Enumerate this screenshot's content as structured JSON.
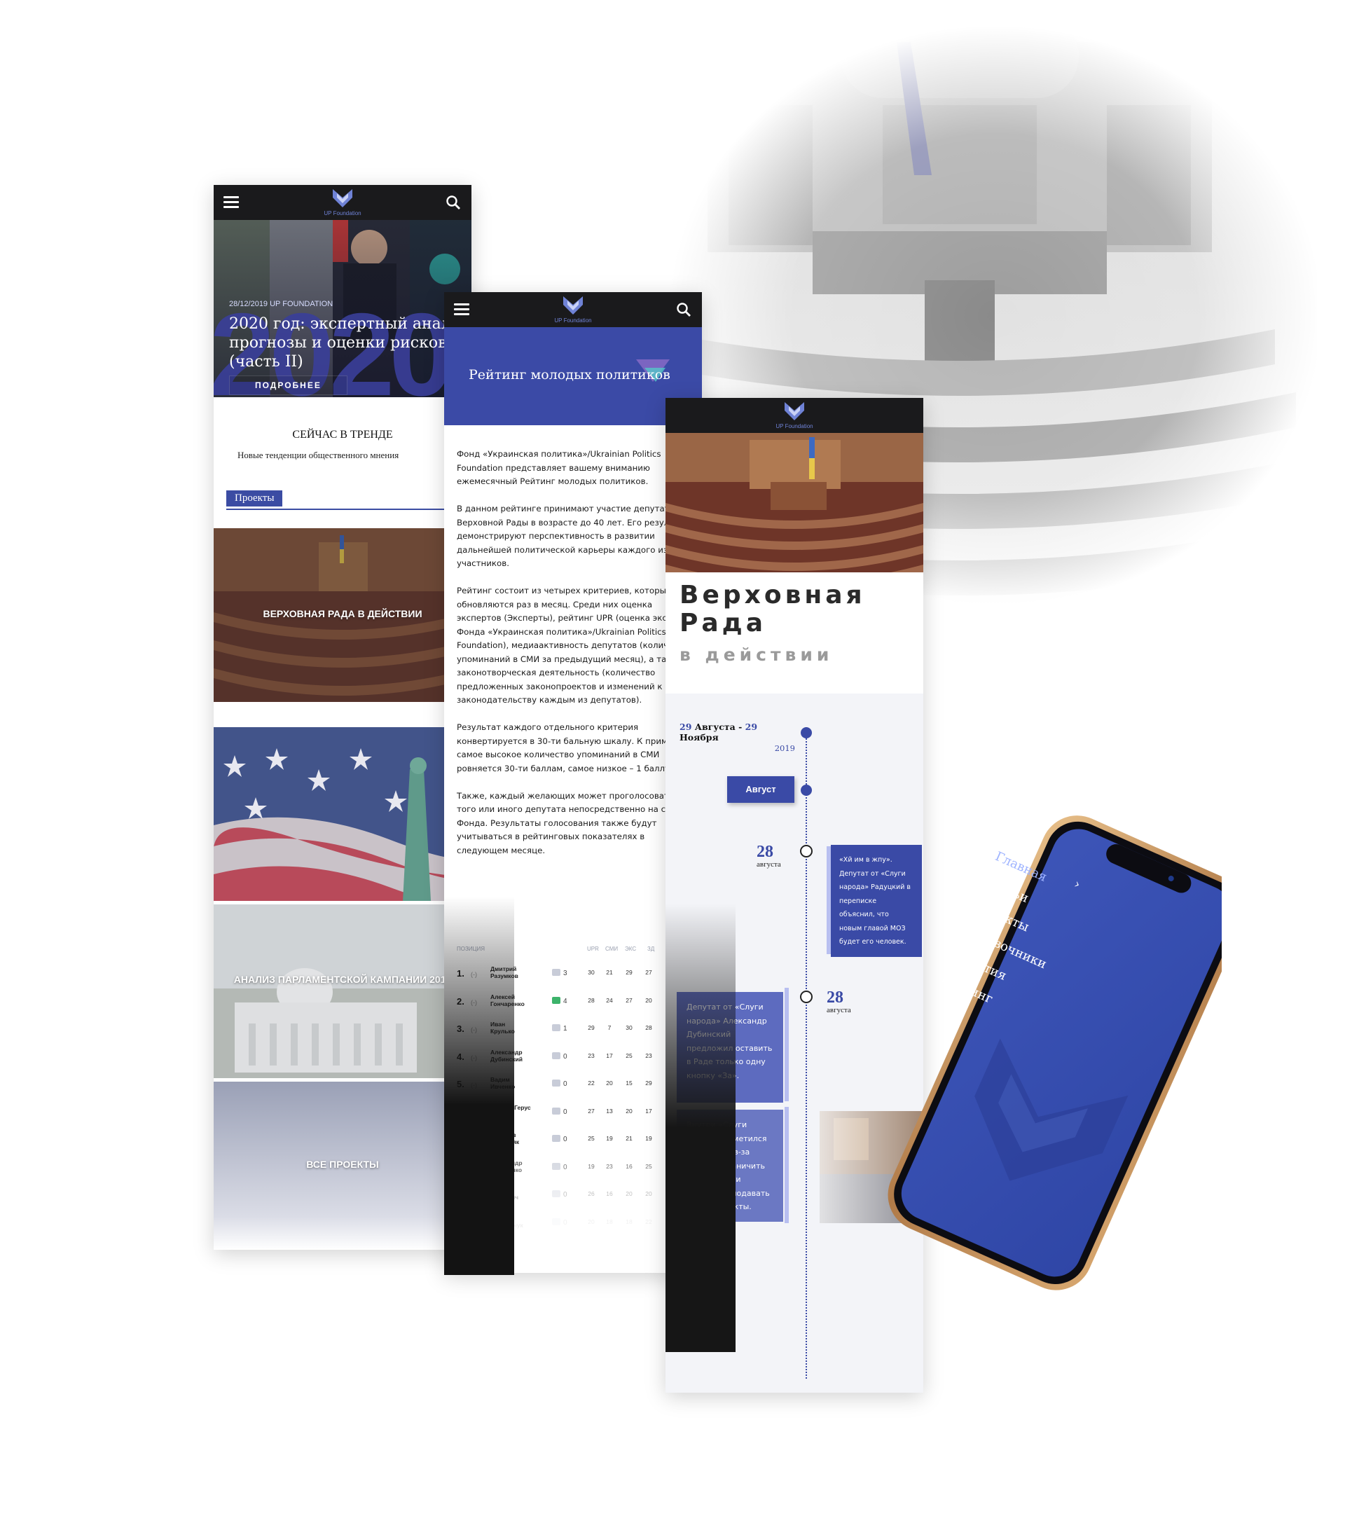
{
  "brand": {
    "logo_text": "UP Foundation"
  },
  "screen1": {
    "hero": {
      "date": "28/12/2019 UP FOUNDATION",
      "title": "2020 год: экспертный анализ, прогнозы и оценки рисков (часть II)",
      "big_year": "2020",
      "button": "ПОДРОБНЕЕ"
    },
    "trend": {
      "title": "СЕЙЧАС В ТРЕНДЕ",
      "subtitle": "Новые тенденции общественного мнения"
    },
    "projects_tab": "Проекты",
    "cards": [
      {
        "caption": "ВЕРХОВНАЯ РАДА В ДЕЙСТВИИ"
      },
      {
        "caption": ""
      },
      {
        "caption": "АНАЛИЗ ПАРЛАМЕНТСКОЙ КАМПАНИИ 2019"
      },
      {
        "caption": "ВСЕ ПРОЕКТЫ"
      }
    ]
  },
  "screen2": {
    "hero_title": "Рейтинг молодых политиков",
    "paragraphs": [
      "Фонд «Украинская политика»/Ukrainian Politics Foundation представляет вашему вниманию ежемесячный Рейтинг молодых политиков.",
      "В данном рейтинге принимают участие депутаты Верховной Рады в возрасте до 40 лет. Его результаты демонстрируют перспективность в развитии дальнейшей политической карьеры каждого из участников.",
      "Рейтинг состоит из четырех критериев, которые обновляются раз в месяц. Среди них оценка экспертов (Эксперты), рейтинг UPR (оценка экспертов Фонда «Украинская политика»/Ukrainian Politics Foundation), медиаактивность депутатов (количество упоминаний в СМИ за предыдущий месяц), а также законотворческая деятельность (количество предложенных законопроектов и изменений к законодательству каждым из депутатов).",
      "Результат каждого отдельного критерия конвертируется в 30-ти бальную шкалу. К примеру, самое высокое количество упоминаний в СМИ ровняется 30-ти баллам, самое низкое – 1 баллу.",
      "Также, каждый желающих может проголосовать за того или иного депутата непосредственно на сайте Фонда. Результаты голосования также будут учитываться в рейтинговых показателях в следующем месяце."
    ],
    "table": {
      "headers": [
        "ПОЗИЦИЯ",
        "UPR",
        "СМИ",
        "ЭКС",
        "ЗД"
      ],
      "rows": [
        {
          "pos": "1.",
          "change": "(-)",
          "name": "Дмитрий Разумков",
          "likes": "3",
          "liked": false,
          "v": [
            "30",
            "21",
            "29",
            "27"
          ]
        },
        {
          "pos": "2.",
          "change": "(-)",
          "name": "Алексей Гончаренко",
          "likes": "4",
          "liked": true,
          "v": [
            "28",
            "24",
            "27",
            "20"
          ]
        },
        {
          "pos": "3.",
          "change": "(-)",
          "name": "Иван Крулько",
          "likes": "1",
          "liked": false,
          "v": [
            "29",
            "7",
            "30",
            "28"
          ]
        },
        {
          "pos": "4.",
          "change": "(-)",
          "name": "Александр Дубинский",
          "likes": "0",
          "liked": false,
          "v": [
            "23",
            "17",
            "25",
            "23"
          ]
        },
        {
          "pos": "5.",
          "change": "(-)",
          "name": "Вадим Ивченко",
          "likes": "0",
          "liked": false,
          "v": [
            "22",
            "20",
            "15",
            "29"
          ]
        },
        {
          "pos": "6.",
          "change": "(-)",
          "name": "Андрей Герус",
          "likes": "0",
          "liked": false,
          "v": [
            "27",
            "13",
            "20",
            "17"
          ]
        },
        {
          "pos": "7.",
          "change": "(-)",
          "name": "Ярослав Железняк",
          "likes": "0",
          "liked": false,
          "v": [
            "25",
            "19",
            "21",
            "19"
          ]
        },
        {
          "pos": "8.",
          "change": "(-)",
          "name": "Александр Корниенко",
          "likes": "0",
          "liked": false,
          "v": [
            "19",
            "23",
            "16",
            "25"
          ]
        },
        {
          "pos": "9.",
          "change": "(-)",
          "name": "Яна Зинкевич",
          "likes": "0",
          "liked": false,
          "v": [
            "26",
            "16",
            "20",
            "20"
          ]
        },
        {
          "pos": "10.",
          "change": "(-)",
          "name": "Олег Мельничук",
          "likes": "0",
          "liked": false,
          "v": [
            "20",
            "18",
            "18",
            "22"
          ]
        }
      ]
    }
  },
  "screen3": {
    "title_line1": "Верховная",
    "title_line2": "Рада",
    "title_line3": "в действии",
    "range": {
      "d1": "29",
      "m1": "Августа",
      "sep": "-",
      "d2": "29",
      "m2": "Ноября",
      "year": "2019"
    },
    "month_button": "Август",
    "events": [
      {
        "day": "28",
        "month": "августа",
        "text": "«Хй им в жпу». Депутат от «Слуги народа» Радуцкий в переписке объяснил, что новым главой МОЗ будет его человек."
      },
      {
        "day": "28",
        "month": "августа",
        "text": "Депутат от «Слуги народа» Александр Дубинский предложил оставить в Раде только одну кнопку «За»."
      },
      {
        "text": "Внутри «Слуги народа» наметился конфликт из-за планов ограничить возможности депутатов подавать законопроекты."
      }
    ]
  },
  "phone_menu": {
    "items": [
      "Главная",
      "Статьи",
      "Проекты",
      "Справочники",
      "События",
      "Рейтинг"
    ],
    "active": "Главная",
    "arrow": "›"
  },
  "colors": {
    "accent": "#3b4aa6",
    "topbar": "#1a1a1c",
    "phone_gold": "#c9955a"
  },
  "icons": [
    "menu-icon",
    "search-icon",
    "logo-icon",
    "chevron-left-icon",
    "thumbs-up-icon",
    "chevron-right-icon"
  ]
}
